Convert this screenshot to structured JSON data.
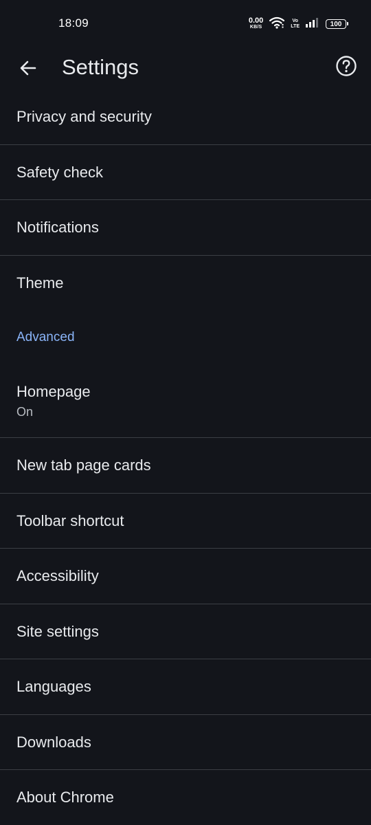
{
  "status": {
    "time": "18:09",
    "net_speed_value": "0.00",
    "net_speed_unit": "KB/S",
    "volte_top": "Vo",
    "volte_bottom": "LTE",
    "battery": "100"
  },
  "toolbar": {
    "title": "Settings",
    "back_icon": "arrow-back-icon",
    "help_icon": "help-circle-icon"
  },
  "items": [
    {
      "title": "Privacy and security"
    },
    {
      "title": "Safety check"
    },
    {
      "title": "Notifications"
    },
    {
      "title": "Theme"
    }
  ],
  "advanced": {
    "header": "Advanced",
    "homepage": {
      "title": "Homepage",
      "subtitle": "On"
    },
    "items": [
      {
        "title": "New tab page cards"
      },
      {
        "title": "Toolbar shortcut"
      },
      {
        "title": "Accessibility"
      },
      {
        "title": "Site settings"
      },
      {
        "title": "Languages"
      },
      {
        "title": "Downloads"
      },
      {
        "title": "About Chrome"
      }
    ]
  },
  "colors": {
    "background": "#13151b",
    "text": "#e8eaed",
    "section_accent": "#8ab4f8",
    "divider": "#3c3f45"
  }
}
